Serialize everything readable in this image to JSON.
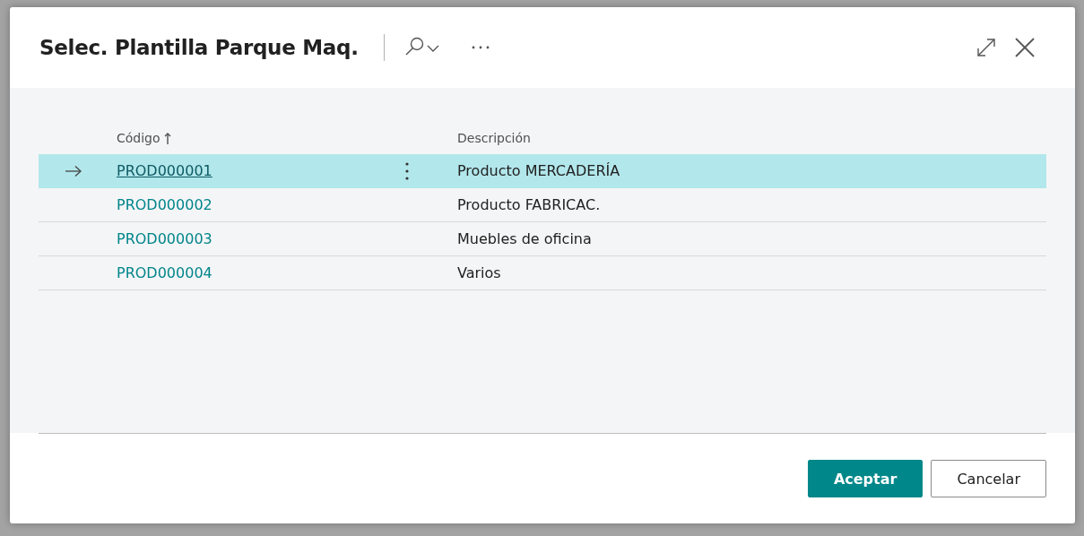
{
  "dialog": {
    "title": "Selec. Plantilla Parque Maq."
  },
  "table": {
    "columns": [
      {
        "label": "Código",
        "sorted": true
      },
      {
        "label": "Descripción",
        "sorted": false
      }
    ],
    "rows": [
      {
        "code": "PROD000001",
        "description": "Producto MERCADERÍA",
        "selected": true
      },
      {
        "code": "PROD000002",
        "description": "Producto FABRICAC.",
        "selected": false
      },
      {
        "code": "PROD000003",
        "description": "Muebles de oficina",
        "selected": false
      },
      {
        "code": "PROD000004",
        "description": "Varios",
        "selected": false
      }
    ]
  },
  "buttons": [
    {
      "label": "Aceptar",
      "kind": "primary"
    },
    {
      "label": "Cancelar",
      "kind": "secondary"
    }
  ]
}
